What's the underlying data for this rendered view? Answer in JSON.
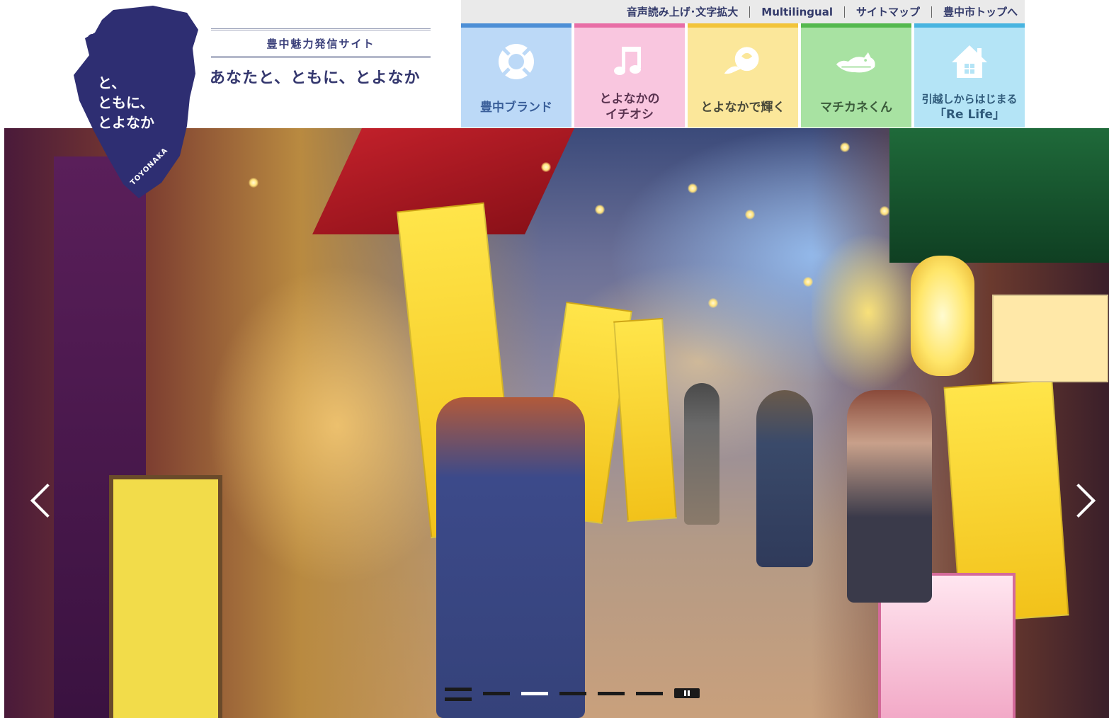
{
  "site": {
    "logo": {
      "lines": [
        "と、",
        "ともに、",
        "とよなか"
      ],
      "english": "TOYONAKA",
      "color": "#2e2e72"
    },
    "subtitle": "豊中魅力発信サイト",
    "tagline": "あなたと、ともに、とよなか"
  },
  "utility_nav": [
    {
      "label": "音声読み上げ･文字拡大"
    },
    {
      "label": "Multilingual"
    },
    {
      "label": "サイトマップ"
    },
    {
      "label": "豊中市トップへ"
    }
  ],
  "main_nav": [
    {
      "label_lines": [
        "豊中ブランド"
      ],
      "icon": "lifebuoy-icon",
      "bg": "#bcd9f7",
      "accent": "#4d8fd6",
      "text": "#3a5f9a"
    },
    {
      "label_lines": [
        "とよなかの",
        "イチオシ"
      ],
      "icon": "music-note-icon",
      "bg": "#f9c6df",
      "accent": "#e86ea6",
      "text": "#5a3350"
    },
    {
      "label_lines": [
        "とよなかで輝く"
      ],
      "icon": "rose-icon",
      "bg": "#fbe79a",
      "accent": "#f2c43a",
      "text": "#4a4a3a"
    },
    {
      "label_lines": [
        "マチカネくん"
      ],
      "icon": "crocodile-icon",
      "bg": "#a8e2a2",
      "accent": "#54b84e",
      "text": "#3a5a3a"
    },
    {
      "label_lines": [
        "引越しからはじまる",
        "「Re Life」"
      ],
      "icon": "house-icon",
      "bg": "#b4e4f6",
      "accent": "#48b4e0",
      "text": "#2f5a7a"
    }
  ],
  "slider": {
    "slide_count": 6,
    "active_index": 2
  }
}
